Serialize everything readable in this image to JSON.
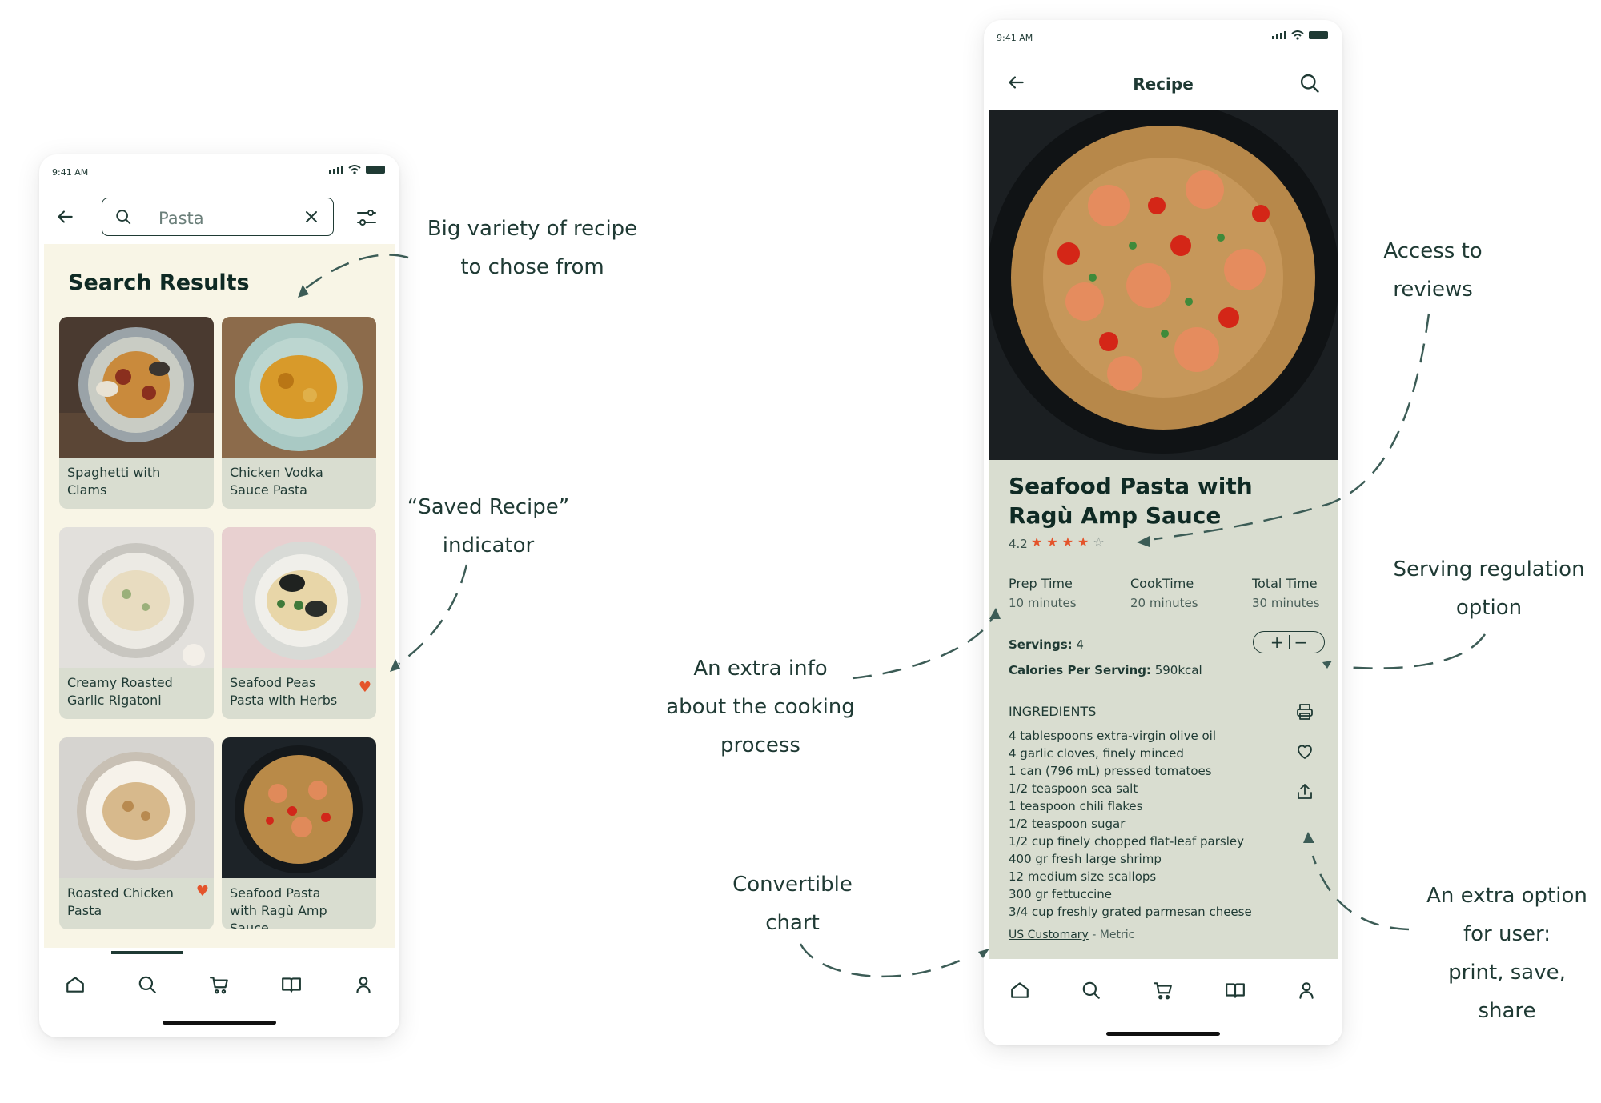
{
  "status_time": "9:41 AM",
  "search_screen": {
    "search_value": "Pasta",
    "results_title": "Search Results",
    "cards": [
      {
        "label": "Spaghetti with Clams",
        "saved": false
      },
      {
        "label": "Chicken Vodka Sauce Pasta",
        "saved": false
      },
      {
        "label": "Creamy Roasted Garlic Rigatoni",
        "saved": false
      },
      {
        "label": "Seafood Peas Pasta with Herbs",
        "saved": true
      },
      {
        "label": "Roasted Chicken Pasta",
        "saved": true
      },
      {
        "label": "Seafood Pasta with Ragù Amp Sauce",
        "saved": false
      }
    ],
    "active_tab": "search"
  },
  "recipe_screen": {
    "header_title": "Recipe",
    "title": "Seafood Pasta with Ragù Amp Sauce",
    "rating": "4.2",
    "stars_filled": 4,
    "stars_total": 5,
    "times": [
      {
        "label": "Prep Time",
        "value": "10 minutes"
      },
      {
        "label": "CookTime",
        "value": "20 minutes"
      },
      {
        "label": "Total Time",
        "value": "30 minutes"
      }
    ],
    "servings_label": "Servings:",
    "servings_value": "4",
    "calories_label": "Calories Per Serving:",
    "calories_value": "590kcal",
    "stepper_plus": "+",
    "stepper_minus": "−",
    "ingredients_heading": "INGREDIENTS",
    "ingredients": [
      "4 tablespoons extra-virgin olive oil",
      "4 garlic cloves, finely minced",
      "1 can (796 mL) pressed tomatoes",
      "1/2 teaspoon sea salt",
      "1 teaspoon chili flakes",
      "1/2 teaspoon sugar",
      "1/2 cup finely chopped flat-leaf parsley",
      "400 gr fresh large shrimp",
      "12 medium size scallops",
      "300 gr fettuccine",
      "3/4 cup freshly grated parmesan cheese"
    ],
    "units_selected": "US Customary",
    "units_separator": " - ",
    "units_other": "Metric"
  },
  "annotations": {
    "variety": [
      "Big variety of recipe",
      "to chose from"
    ],
    "saved": [
      "“Saved Recipe”",
      "indicator"
    ],
    "extra_info": [
      "An extra info",
      "about the cooking process"
    ],
    "convertible": [
      "Convertible",
      "chart"
    ],
    "reviews": [
      "Access to",
      "reviews"
    ],
    "serving": [
      "Serving regulation",
      "option"
    ],
    "extra_option": [
      "An extra option",
      "for user:",
      "print, save, share"
    ]
  },
  "colors": {
    "primary_dark": "#1f3a34",
    "panel_sage": "#d9ddd0",
    "cream_bg": "#f8f5e6",
    "accent_heart": "#e4542b"
  }
}
